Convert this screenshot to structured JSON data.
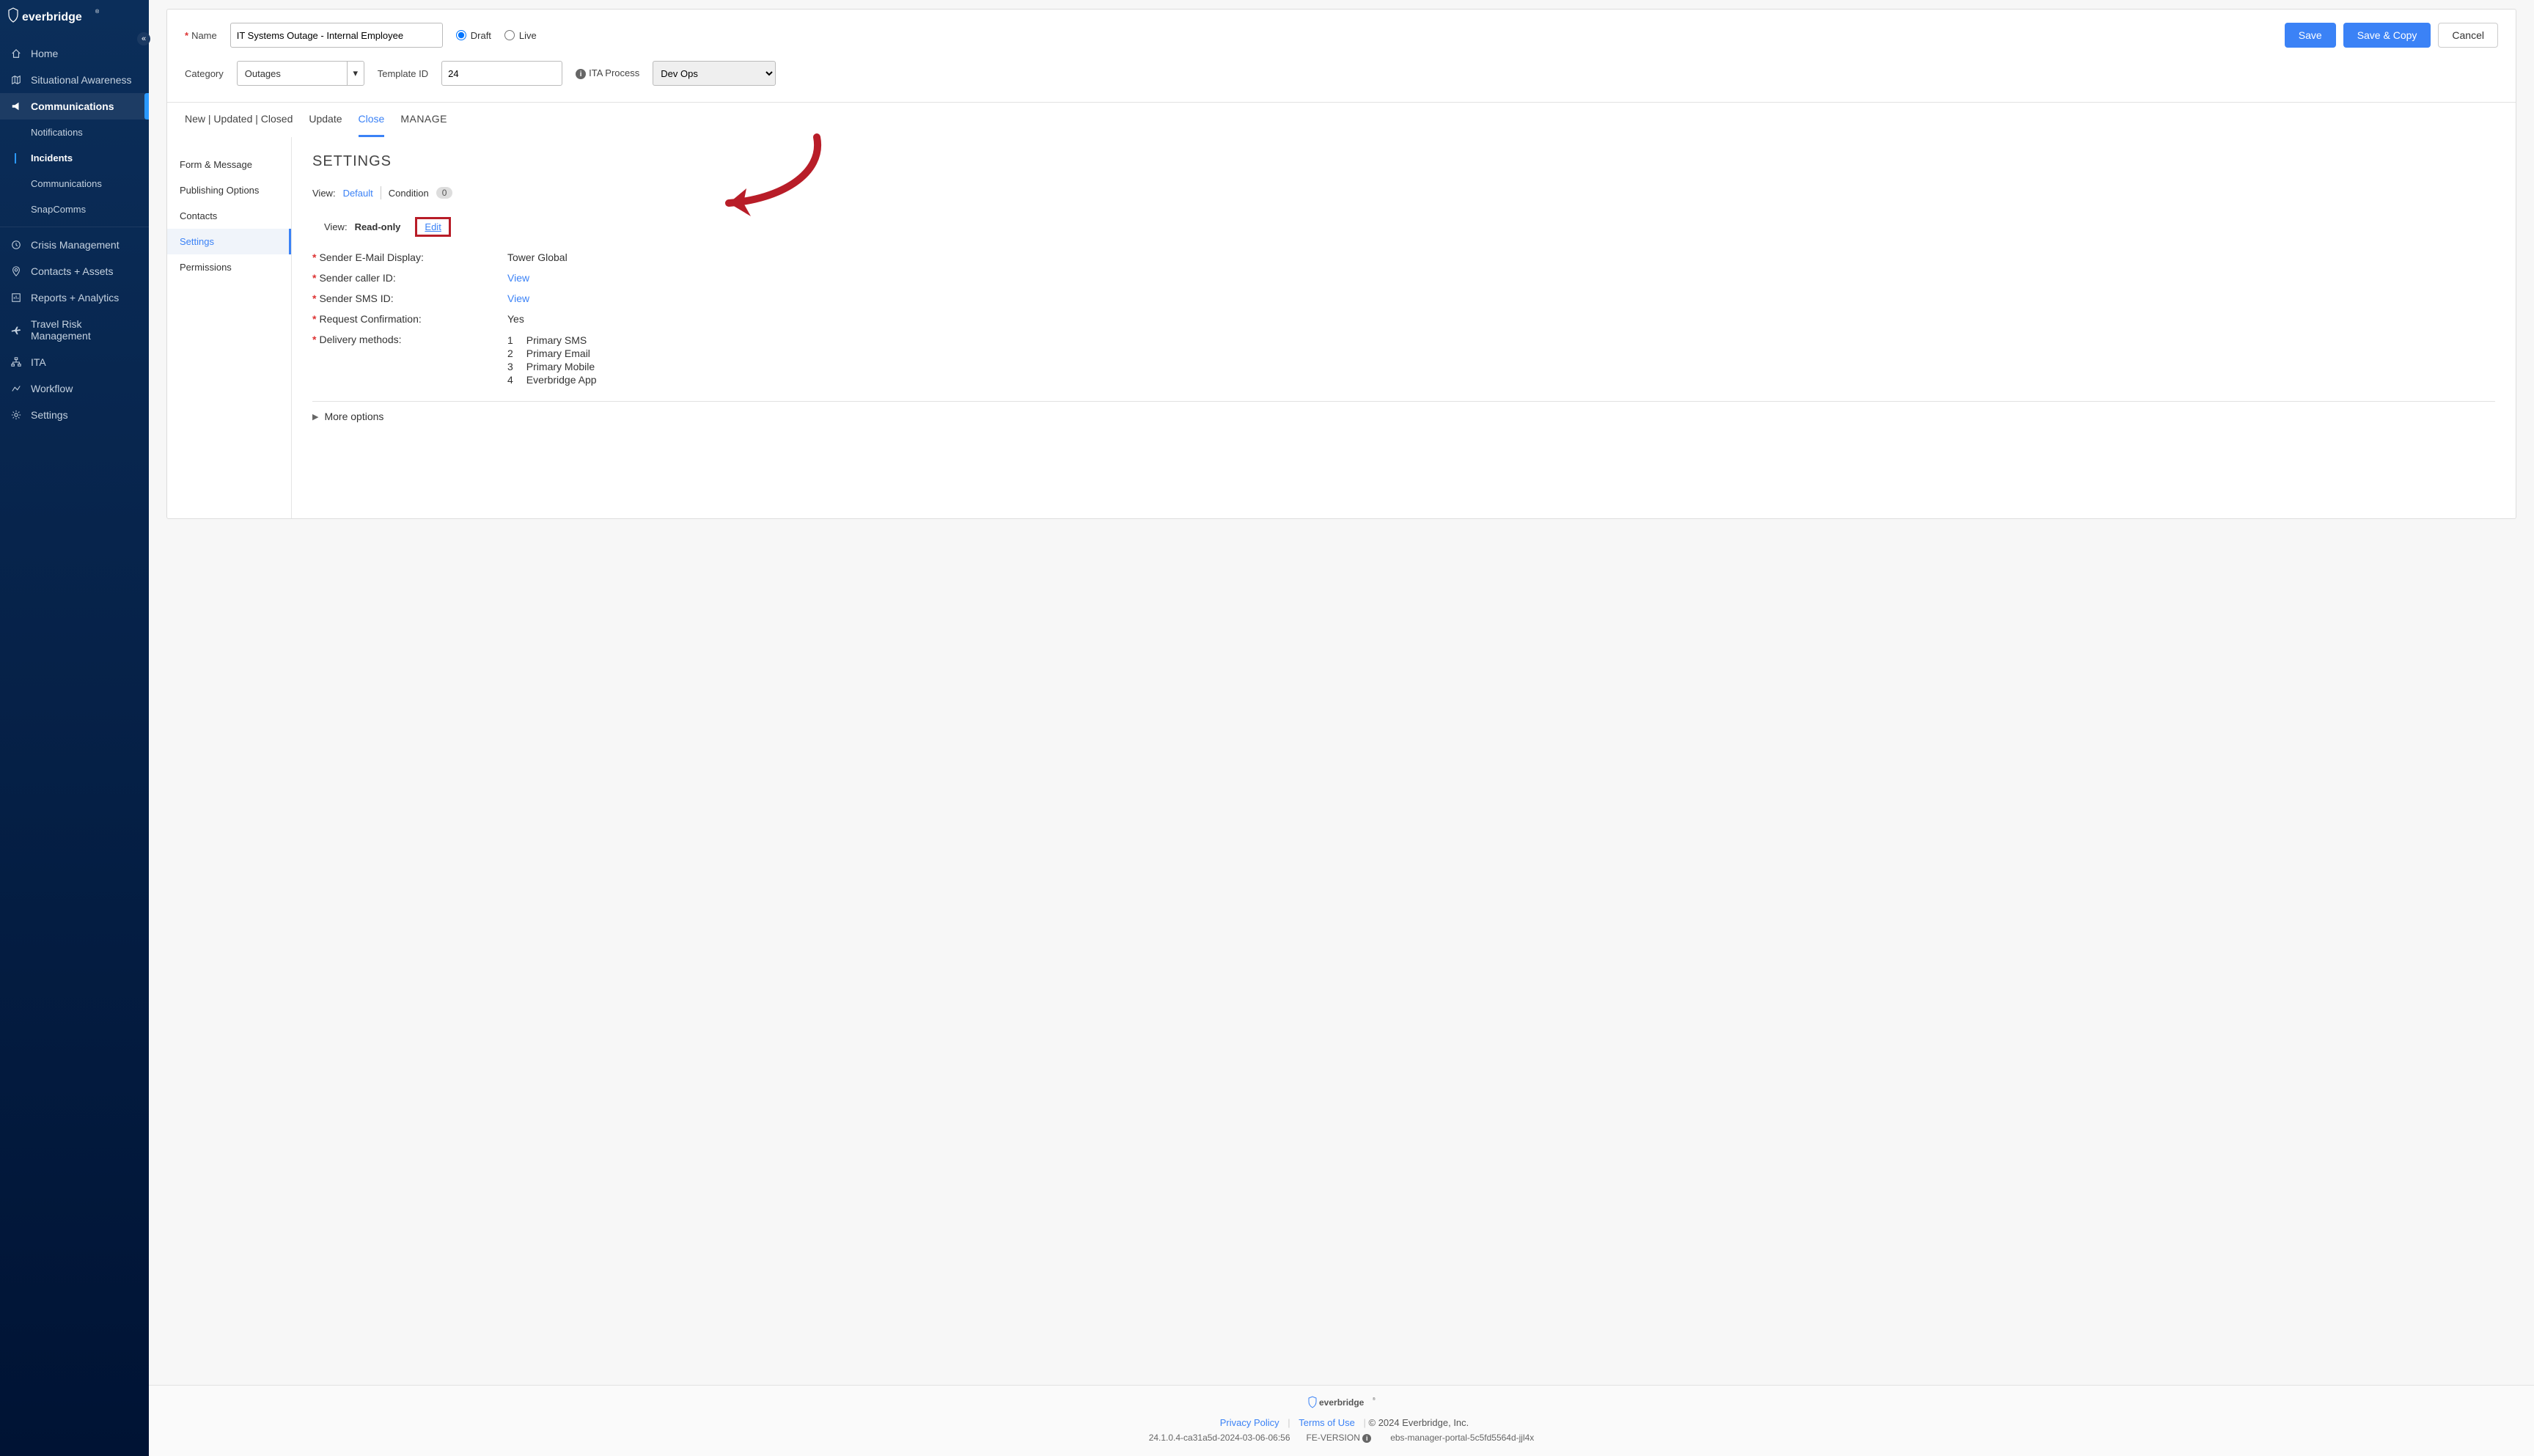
{
  "brand": "everbridge",
  "sidebar": {
    "items": [
      {
        "label": "Home",
        "icon": "home-icon"
      },
      {
        "label": "Situational Awareness",
        "icon": "map-icon"
      },
      {
        "label": "Communications",
        "icon": "bullhorn-icon"
      },
      {
        "label": "Notifications"
      },
      {
        "label": "Incidents"
      },
      {
        "label": "Communications"
      },
      {
        "label": "SnapComms"
      },
      {
        "label": "Crisis Management",
        "icon": "clock-icon"
      },
      {
        "label": "Contacts + Assets",
        "icon": "pin-icon"
      },
      {
        "label": "Reports + Analytics",
        "icon": "chart-icon"
      },
      {
        "label": "Travel Risk Management",
        "icon": "plane-icon"
      },
      {
        "label": "ITA",
        "icon": "sitemap-icon"
      },
      {
        "label": "Workflow",
        "icon": "workflow-icon"
      },
      {
        "label": "Settings",
        "icon": "gear-icon"
      }
    ]
  },
  "top": {
    "name_label": "Name",
    "name_value": "IT Systems Outage - Internal Employee",
    "draft_label": "Draft",
    "live_label": "Live",
    "save": "Save",
    "save_copy": "Save & Copy",
    "cancel": "Cancel",
    "category_label": "Category",
    "category_value": "Outages",
    "tpl_id_label": "Template ID",
    "tpl_id_value": "24",
    "ita_label": "ITA Process",
    "ita_value": "Dev Ops"
  },
  "tabs": {
    "new": "New | Updated | Closed",
    "update": "Update",
    "close": "Close",
    "manage": "MANAGE"
  },
  "leftnav": {
    "form": "Form & Message",
    "publish": "Publishing Options",
    "contacts": "Contacts",
    "settings": "Settings",
    "permissions": "Permissions"
  },
  "settings": {
    "heading": "SETTINGS",
    "view_label": "View:",
    "default": "Default",
    "condition": "Condition",
    "condition_count": "0",
    "mode_label": "View:",
    "mode_value": "Read-only",
    "edit": "Edit",
    "fields": {
      "email_display": {
        "k": "Sender E-Mail Display:",
        "v": "Tower Global"
      },
      "caller_id": {
        "k": "Sender caller ID:",
        "v": "View"
      },
      "sms_id": {
        "k": "Sender SMS ID:",
        "v": "View"
      },
      "confirm": {
        "k": "Request Confirmation:",
        "v": "Yes"
      },
      "delivery": {
        "k": "Delivery methods:",
        "items": [
          {
            "n": "1",
            "v": "Primary SMS"
          },
          {
            "n": "2",
            "v": "Primary Email"
          },
          {
            "n": "3",
            "v": "Primary Mobile"
          },
          {
            "n": "4",
            "v": "Everbridge App"
          }
        ]
      }
    },
    "more": "More options"
  },
  "footer": {
    "brand": "everbridge",
    "privacy": "Privacy Policy",
    "terms": "Terms of Use",
    "copyright": "© 2024 Everbridge, Inc.",
    "build": "24.1.0.4-ca31a5d-2024-03-06-06:56",
    "fe": "FE-VERSION",
    "pod": "ebs-manager-portal-5c5fd5564d-jjl4x"
  }
}
